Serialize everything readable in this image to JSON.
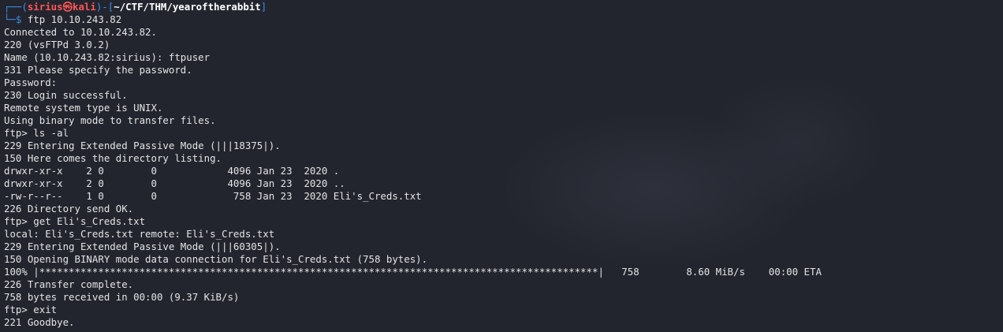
{
  "prompt": {
    "corner_top": "┌──(",
    "user_host": "sirius㉿kali",
    "mid": ")-[",
    "path": "~/CTF/THM/yearoftherabbit",
    "close": "]",
    "corner_bottom": "└─",
    "dollar": "$ ",
    "command": "ftp 10.10.243.82"
  },
  "output_lines": [
    "Connected to 10.10.243.82.",
    "220 (vsFTPd 3.0.2)",
    "Name (10.10.243.82:sirius): ftpuser",
    "331 Please specify the password.",
    "Password:",
    "230 Login successful.",
    "Remote system type is UNIX.",
    "Using binary mode to transfer files.",
    "ftp> ls -al",
    "229 Entering Extended Passive Mode (|||18375|).",
    "150 Here comes the directory listing.",
    "drwxr-xr-x    2 0        0            4096 Jan 23  2020 .",
    "drwxr-xr-x    2 0        0            4096 Jan 23  2020 ..",
    "-rw-r--r--    1 0        0             758 Jan 23  2020 Eli's_Creds.txt",
    "226 Directory send OK.",
    "ftp> get Eli's_Creds.txt",
    "local: Eli's_Creds.txt remote: Eli's_Creds.txt",
    "229 Entering Extended Passive Mode (|||60305|).",
    "150 Opening BINARY mode data connection for Eli's_Creds.txt (758 bytes).",
    "100% |***********************************************************************************************|   758        8.60 MiB/s    00:00 ETA",
    "226 Transfer complete.",
    "758 bytes received in 00:00 (9.37 KiB/s)",
    "ftp> exit",
    "221 Goodbye."
  ],
  "colors": {
    "background": "#23252e",
    "prompt_frame": "#3b8eea",
    "user_host": "#ff5555",
    "path": "#ffffff",
    "text": "#e4e4e4"
  }
}
